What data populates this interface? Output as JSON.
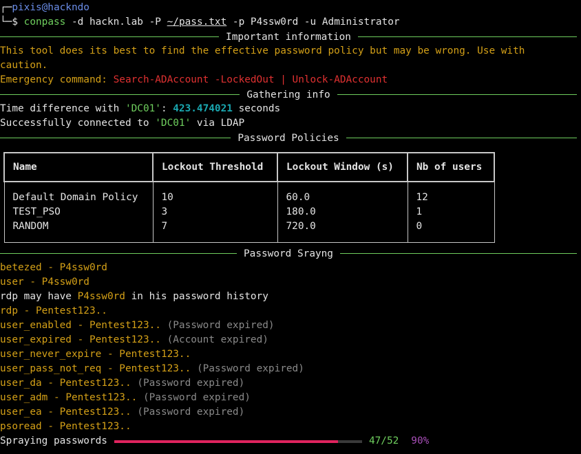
{
  "prompt": {
    "corner_top": "┌─",
    "user_host": "pixis@hackndo",
    "corner_bottom": "└─",
    "dollar": "$",
    "cmd": "conpass",
    "args_a": " -d hackn.lab -P ",
    "file": "~/pass.txt",
    "args_b": " -p P4ssw0rd -u Administrator"
  },
  "sections": {
    "important": "Important information",
    "gathering": "Gathering info",
    "policies": "Password Policies",
    "spraying": "Password Srayng"
  },
  "important": {
    "warning_line1": "This tool does its best to find the effective password policy but may be wrong. Use with",
    "warning_line2": "caution.",
    "emergency_label": "Emergency command: ",
    "emergency_cmd": "Search-ADAccount -LockedOut | Unlock-ADAccount"
  },
  "gathering": {
    "time_prefix": "Time difference with ",
    "dc_name": "'DC01'",
    "time_sep": ": ",
    "time_value": "423.474021",
    "time_suffix": " seconds",
    "conn_prefix": "Successfully connected to ",
    "conn_suffix": " via LDAP"
  },
  "table": {
    "headers": [
      "Name",
      "Lockout Threshold",
      "Lockout Window (s)",
      "Nb of users"
    ],
    "rows": [
      [
        "Default Domain Policy",
        "10",
        "60.0",
        "12"
      ],
      [
        "TEST_PSO",
        "3",
        "180.0",
        "1"
      ],
      [
        "RANDOM",
        "7",
        "720.0",
        "0"
      ]
    ]
  },
  "spray": {
    "l1_user": "betezed",
    "l1_pass": "P4ssw0rd",
    "l2_user": "user",
    "l2_pass": "P4ssw0rd",
    "l3_user": "rdp",
    "l3_mid": " may have ",
    "l3_pass": "P4ssw0rd",
    "l3_end": " in his password history",
    "l4_user": "rdp",
    "l4_pass": "Pentest123..",
    "l5_user": "user_enabled",
    "l5_pass": "Pentest123..",
    "l5_note": "(Password expired)",
    "l6_user": "user_expired",
    "l6_pass": "Pentest123..",
    "l6_note": "(Account expired)",
    "l7_user": "user_never_expire",
    "l7_pass": "Pentest123..",
    "l8_user": "user_pass_not_req",
    "l8_pass": "Pentest123..",
    "l8_note": "(Password expired)",
    "l9_user": "user_da",
    "l9_pass": "Pentest123..",
    "l9_note": "(Password expired)",
    "l10_user": "user_adm",
    "l10_pass": "Pentest123..",
    "l10_note": "(Password expired)",
    "l11_user": "user_ea",
    "l11_pass": "Pentest123..",
    "l11_note": "(Password expired)",
    "l12_user": "psoread",
    "l12_pass": "Pentest123..",
    "dash": " - "
  },
  "progress": {
    "label": "Spraying passwords",
    "count": "47/52",
    "percent": "90%",
    "fraction": 0.9038
  }
}
